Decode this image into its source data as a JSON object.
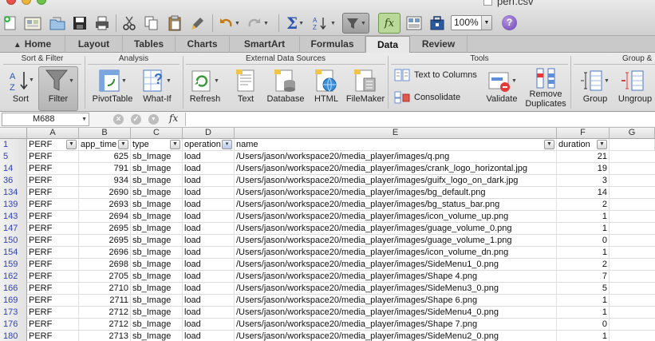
{
  "window": {
    "title": "perf.csv"
  },
  "toolbar": {
    "zoom": "100%",
    "help": "?"
  },
  "tabs": [
    "Home",
    "Layout",
    "Tables",
    "Charts",
    "SmartArt",
    "Formulas",
    "Data",
    "Review"
  ],
  "ribbon": {
    "groups": [
      "Sort & Filter",
      "Analysis",
      "External Data Sources",
      "Tools",
      "Group &"
    ],
    "sort": "Sort",
    "filter": "Filter",
    "pivot": "PivotTable",
    "whatif": "What-If",
    "refresh": "Refresh",
    "text": "Text",
    "database": "Database",
    "html": "HTML",
    "filemaker": "FileMaker",
    "text_to_columns": "Text to Columns",
    "consolidate": "Consolidate",
    "validate": "Validate",
    "remove_dup_1": "Remove",
    "remove_dup_2": "Duplicates",
    "group": "Group",
    "ungroup": "Ungroup"
  },
  "formula_bar": {
    "name_box": "M688",
    "fx": "fx",
    "cancel": "×",
    "confirm": "✓",
    "value": ""
  },
  "columns": [
    "A",
    "B",
    "C",
    "D",
    "E",
    "F",
    "G"
  ],
  "header_row": {
    "row": "1",
    "cells": [
      "PERF",
      "app_time",
      "type",
      "operation",
      "name",
      "duration",
      ""
    ]
  },
  "rows": [
    {
      "row": "5",
      "cells": [
        "PERF",
        "625",
        "sb_Image",
        "load",
        "/Users/jason/workspace20/media_player/images/q.png",
        "21"
      ]
    },
    {
      "row": "14",
      "cells": [
        "PERF",
        "791",
        "sb_Image",
        "load",
        "/Users/jason/workspace20/media_player/images/crank_logo_horizontal.jpg",
        "19"
      ]
    },
    {
      "row": "36",
      "cells": [
        "PERF",
        "934",
        "sb_Image",
        "load",
        "/Users/jason/workspace20/media_player/images/guifx_logo_on_dark.jpg",
        "3"
      ]
    },
    {
      "row": "134",
      "cells": [
        "PERF",
        "2690",
        "sb_Image",
        "load",
        "/Users/jason/workspace20/media_player/images/bg_default.png",
        "14"
      ]
    },
    {
      "row": "139",
      "cells": [
        "PERF",
        "2693",
        "sb_Image",
        "load",
        "/Users/jason/workspace20/media_player/images/bg_status_bar.png",
        "2"
      ]
    },
    {
      "row": "143",
      "cells": [
        "PERF",
        "2694",
        "sb_Image",
        "load",
        "/Users/jason/workspace20/media_player/images/icon_volume_up.png",
        "1"
      ]
    },
    {
      "row": "147",
      "cells": [
        "PERF",
        "2695",
        "sb_Image",
        "load",
        "/Users/jason/workspace20/media_player/images/guage_volume_0.png",
        "1"
      ]
    },
    {
      "row": "150",
      "cells": [
        "PERF",
        "2695",
        "sb_Image",
        "load",
        "/Users/jason/workspace20/media_player/images/guage_volume_1.png",
        "0"
      ]
    },
    {
      "row": "154",
      "cells": [
        "PERF",
        "2696",
        "sb_Image",
        "load",
        "/Users/jason/workspace20/media_player/images/icon_volume_dn.png",
        "1"
      ]
    },
    {
      "row": "159",
      "cells": [
        "PERF",
        "2698",
        "sb_Image",
        "load",
        "/Users/jason/workspace20/media_player/images/SideMenu1_0.png",
        "2"
      ]
    },
    {
      "row": "162",
      "cells": [
        "PERF",
        "2705",
        "sb_Image",
        "load",
        "/Users/jason/workspace20/media_player/images/Shape 4.png",
        "7"
      ]
    },
    {
      "row": "166",
      "cells": [
        "PERF",
        "2710",
        "sb_Image",
        "load",
        "/Users/jason/workspace20/media_player/images/SideMenu3_0.png",
        "5"
      ]
    },
    {
      "row": "169",
      "cells": [
        "PERF",
        "2711",
        "sb_Image",
        "load",
        "/Users/jason/workspace20/media_player/images/Shape 6.png",
        "1"
      ]
    },
    {
      "row": "173",
      "cells": [
        "PERF",
        "2712",
        "sb_Image",
        "load",
        "/Users/jason/workspace20/media_player/images/SideMenu4_0.png",
        "1"
      ]
    },
    {
      "row": "176",
      "cells": [
        "PERF",
        "2712",
        "sb_Image",
        "load",
        "/Users/jason/workspace20/media_player/images/Shape 7.png",
        "0"
      ]
    },
    {
      "row": "180",
      "cells": [
        "PERF",
        "2713",
        "sb_Image",
        "load",
        "/Users/jason/workspace20/media_player/images/SideMenu2_0.png",
        "1"
      ]
    }
  ]
}
